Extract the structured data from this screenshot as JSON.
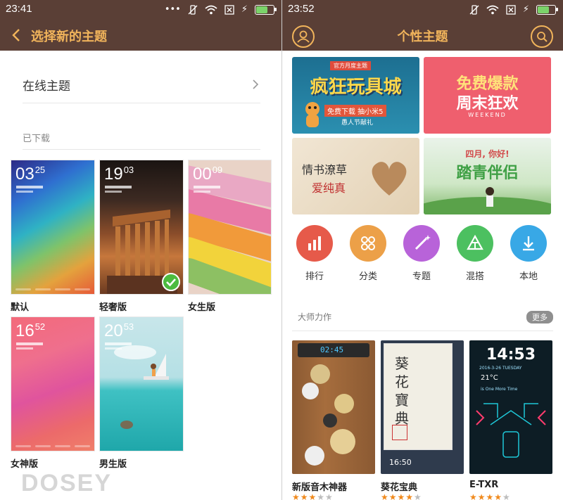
{
  "left": {
    "status": {
      "time": "23:41"
    },
    "appbar": {
      "title": "选择新的主题"
    },
    "online_row": {
      "label": "在线主题"
    },
    "downloaded": {
      "label": "已下载"
    },
    "themes": [
      {
        "name": "默认",
        "clock_h": "03",
        "clock_m": "25",
        "selected": false
      },
      {
        "name": "轻奢版",
        "clock_h": "19",
        "clock_m": "03",
        "selected": true
      },
      {
        "name": "女生版",
        "clock_h": "00",
        "clock_m": "09",
        "selected": false
      },
      {
        "name": "女神版",
        "clock_h": "16",
        "clock_m": "52",
        "selected": false
      },
      {
        "name": "男生版",
        "clock_h": "20",
        "clock_m": "53",
        "selected": false
      }
    ],
    "watermark": "DOSEY"
  },
  "right": {
    "status": {
      "time": "23:52"
    },
    "appbar": {
      "title": "个性主题"
    },
    "banners": [
      {
        "tag": "官方月度主题",
        "headline": "疯狂玩具城",
        "sub": "免费下载 抽小米5",
        "sub2": "愚人节献礼"
      },
      {
        "headline": "免费爆款",
        "headline2": "周末狂欢",
        "sub": "WEEKEND"
      },
      {
        "headline": "情书潦草",
        "headline2": "爱纯真"
      },
      {
        "headline": "四月, 你好!",
        "headline2": "踏青伴侣"
      }
    ],
    "categories": [
      {
        "label": "排行",
        "icon": "bar-chart-icon",
        "color": "#e65a4a"
      },
      {
        "label": "分类",
        "icon": "grid-circles-icon",
        "color": "#eca048"
      },
      {
        "label": "专题",
        "icon": "magic-wand-icon",
        "color": "#b863d9"
      },
      {
        "label": "混搭",
        "icon": "triangles-icon",
        "color": "#4cc060"
      },
      {
        "label": "本地",
        "icon": "download-icon",
        "color": "#38a8e6"
      }
    ],
    "masters": {
      "label": "大师力作",
      "more": "更多"
    },
    "cards": [
      {
        "name": "新版音木神器",
        "rating": 3.5,
        "display": "02:45"
      },
      {
        "name": "葵花宝典",
        "rating": 4.5,
        "book_title": "葵花寶典",
        "clock": "16:50"
      },
      {
        "name": "E-TXR",
        "rating": 4.5,
        "clock": "14:53",
        "date": "2016-3-26 TUESDAY",
        "temp": "21°C",
        "music": "is One More Time"
      }
    ]
  },
  "colors": {
    "appbar_bg": "#5a3f36",
    "accent": "#f1b45b",
    "selected_check": "#4cbb3f",
    "star_on": "#f08a1d",
    "star_off": "#bdbdbd"
  }
}
